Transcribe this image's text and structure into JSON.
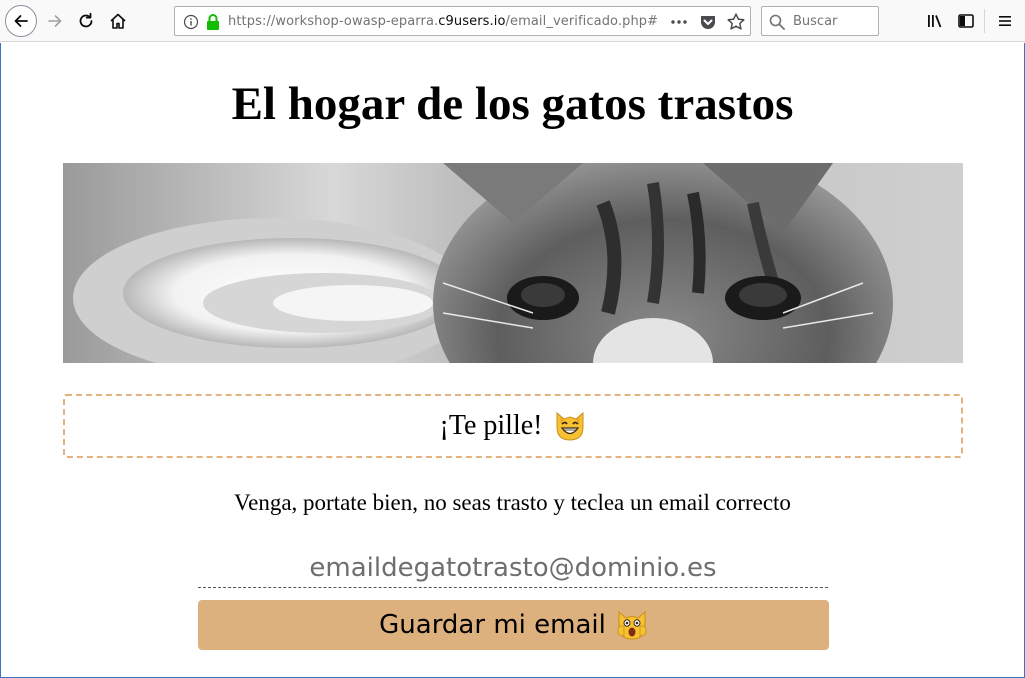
{
  "browser": {
    "url_prefix": "https://workshop-owasp-eparra.",
    "url_host": "c9users.io",
    "url_path": "/email_verificado.php#",
    "search_placeholder": "Buscar"
  },
  "page": {
    "title": "El hogar de los gatos trastos",
    "alert_text": "¡Te pille!",
    "alert_icon": "grinning-cat-icon",
    "instructions": "Venga, portate bien, no seas trasto y teclea un email correcto",
    "email_placeholder": "emaildegatotrasto@dominio.es",
    "save_label": "Guardar mi email",
    "save_icon": "weary-cat-icon"
  },
  "colors": {
    "accent": "#ddb17d",
    "alert_border": "#e3b27e"
  }
}
